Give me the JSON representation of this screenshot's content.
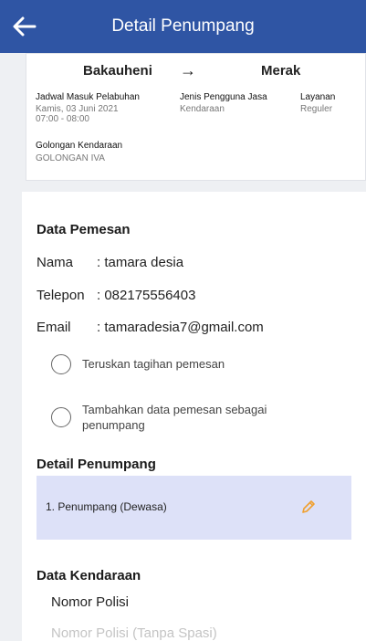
{
  "header": {
    "title": "Detail Penumpang"
  },
  "route": {
    "from": "Bakauheni",
    "arrow": "→",
    "to": "Merak",
    "schedule_label": "Jadwal Masuk Pelabuhan",
    "schedule_date": "Kamis, 03 Juni 2021",
    "schedule_time": "07:00 - 08:00",
    "service_user_label": "Jenis Pengguna Jasa",
    "service_user_value": "Kendaraan",
    "service_label": "Layanan",
    "service_value": "Reguler",
    "vehicle_class_label": "Golongan Kendaraan",
    "vehicle_class_value": "GOLONGAN IVA"
  },
  "orderer": {
    "title": "Data Pemesan",
    "name_label": "Nama",
    "name_value": ": tamara desia",
    "phone_label": "Telepon",
    "phone_value": ": 082175556403",
    "email_label": "Email",
    "email_value": ": tamaradesia7@gmail.com",
    "option_forward_bill": "Teruskan tagihan pemesan",
    "option_add_as_passenger": "Tambahkan data pemesan sebagai penumpang"
  },
  "passengers": {
    "title": "Detail Penumpang",
    "items": [
      {
        "label": "1. Penumpang (Dewasa)"
      }
    ]
  },
  "vehicle": {
    "title": "Data Kendaraan",
    "plate_label": "Nomor Polisi",
    "plate_placeholder": "Nomor Polisi (Tanpa Spasi)",
    "plate_value": ""
  },
  "colors": {
    "header_bg": "#2f55a4",
    "passenger_box_bg": "#dde1f8",
    "edit_icon": "#f0a030"
  },
  "icons": {
    "back": "arrow-left-icon",
    "edit": "pencil-icon"
  }
}
